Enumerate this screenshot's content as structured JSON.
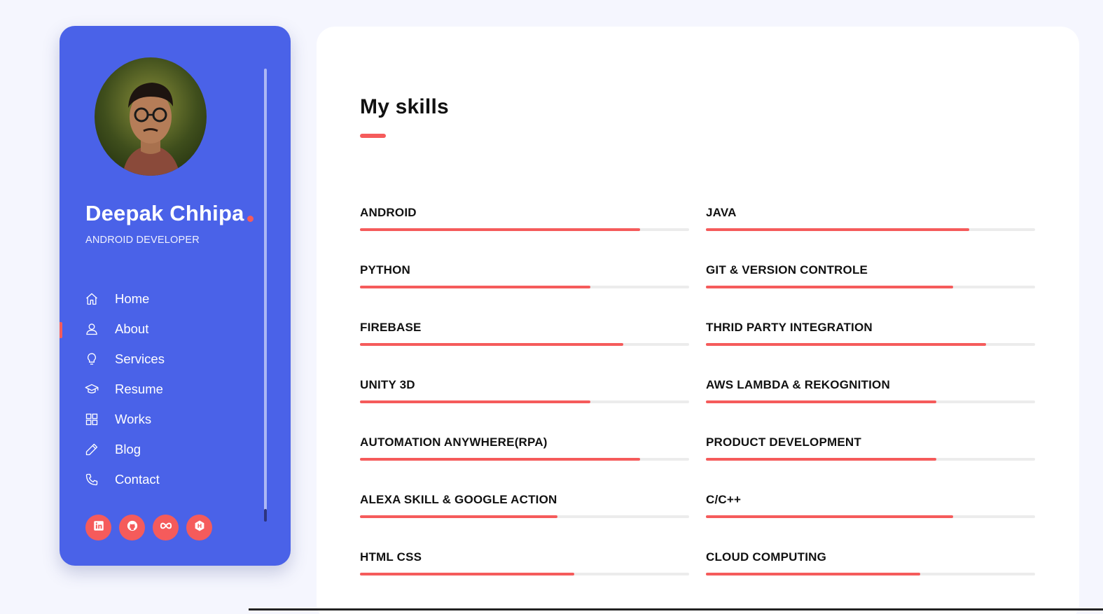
{
  "profile": {
    "name": "Deepak Chhipa",
    "role": "ANDROID DEVELOPER",
    "avatar": "profile-photo"
  },
  "nav": [
    {
      "label": "Home",
      "icon": "home-icon",
      "active": false
    },
    {
      "label": "About",
      "icon": "user-icon",
      "active": true
    },
    {
      "label": "Services",
      "icon": "bulb-icon",
      "active": false
    },
    {
      "label": "Resume",
      "icon": "graduation-cap-icon",
      "active": false
    },
    {
      "label": "Works",
      "icon": "grid-icon",
      "active": false
    },
    {
      "label": "Blog",
      "icon": "pencil-icon",
      "active": false
    },
    {
      "label": "Contact",
      "icon": "phone-icon",
      "active": false
    }
  ],
  "socials": [
    "linkedin-icon",
    "github-icon",
    "infinity-icon",
    "hackerrank-icon"
  ],
  "main": {
    "title": "My skills",
    "skills": [
      {
        "label": "ANDROID",
        "percent": 85
      },
      {
        "label": "JAVA",
        "percent": 80
      },
      {
        "label": "PYTHON",
        "percent": 70
      },
      {
        "label": "GIT & VERSION CONTROLE",
        "percent": 75
      },
      {
        "label": "FIREBASE",
        "percent": 80
      },
      {
        "label": "THRID PARTY INTEGRATION",
        "percent": 85
      },
      {
        "label": "UNITY 3D",
        "percent": 70
      },
      {
        "label": "AWS LAMBDA & REKOGNITION",
        "percent": 70
      },
      {
        "label": "AUTOMATION ANYWHERE(RPA)",
        "percent": 85
      },
      {
        "label": "PRODUCT DEVELOPMENT",
        "percent": 70
      },
      {
        "label": "ALEXA SKILL & GOOGLE ACTION",
        "percent": 60
      },
      {
        "label": "C/C++",
        "percent": 75
      },
      {
        "label": "HTML CSS",
        "percent": 65
      },
      {
        "label": "CLOUD COMPUTING",
        "percent": 65
      }
    ]
  },
  "colors": {
    "sidebar": "#4a62e8",
    "accent": "#f55b5b",
    "background": "#f5f6fe"
  }
}
